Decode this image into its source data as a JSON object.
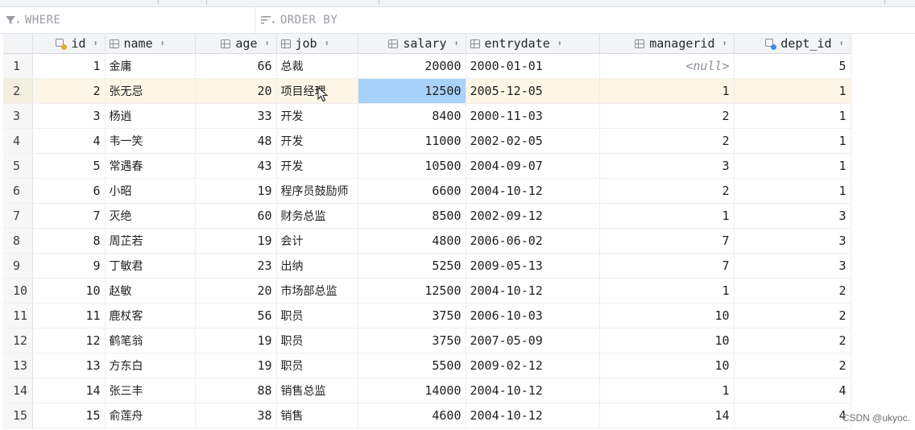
{
  "filter": {
    "where_placeholder": "WHERE",
    "orderby_placeholder": "ORDER BY"
  },
  "columns": [
    {
      "key": "id",
      "label": "id",
      "icon": "primary-key-icon"
    },
    {
      "key": "name",
      "label": "name",
      "icon": "column-icon"
    },
    {
      "key": "age",
      "label": "age",
      "icon": "column-icon"
    },
    {
      "key": "job",
      "label": "job",
      "icon": "column-icon"
    },
    {
      "key": "salary",
      "label": "salary",
      "icon": "column-icon"
    },
    {
      "key": "entrydate",
      "label": "entrydate",
      "icon": "column-icon"
    },
    {
      "key": "managerid",
      "label": "managerid",
      "icon": "column-icon"
    },
    {
      "key": "dept_id",
      "label": "dept_id",
      "icon": "foreign-key-icon"
    }
  ],
  "rows": [
    {
      "n": "1",
      "id": "1",
      "name": "金庸",
      "age": "66",
      "job": "总裁",
      "salary": "20000",
      "entrydate": "2000-01-01",
      "managerid": "<null>",
      "dept_id": "5"
    },
    {
      "n": "2",
      "id": "2",
      "name": "张无忌",
      "age": "20",
      "job": "项目经理",
      "salary": "12500",
      "entrydate": "2005-12-05",
      "managerid": "1",
      "dept_id": "1"
    },
    {
      "n": "3",
      "id": "3",
      "name": "杨逍",
      "age": "33",
      "job": "开发",
      "salary": "8400",
      "entrydate": "2000-11-03",
      "managerid": "2",
      "dept_id": "1"
    },
    {
      "n": "4",
      "id": "4",
      "name": "韦一笑",
      "age": "48",
      "job": "开发",
      "salary": "11000",
      "entrydate": "2002-02-05",
      "managerid": "2",
      "dept_id": "1"
    },
    {
      "n": "5",
      "id": "5",
      "name": "常遇春",
      "age": "43",
      "job": "开发",
      "salary": "10500",
      "entrydate": "2004-09-07",
      "managerid": "3",
      "dept_id": "1"
    },
    {
      "n": "6",
      "id": "6",
      "name": "小昭",
      "age": "19",
      "job": "程序员鼓励师",
      "salary": "6600",
      "entrydate": "2004-10-12",
      "managerid": "2",
      "dept_id": "1"
    },
    {
      "n": "7",
      "id": "7",
      "name": "灭绝",
      "age": "60",
      "job": "财务总监",
      "salary": "8500",
      "entrydate": "2002-09-12",
      "managerid": "1",
      "dept_id": "3"
    },
    {
      "n": "8",
      "id": "8",
      "name": "周芷若",
      "age": "19",
      "job": "会计",
      "salary": "4800",
      "entrydate": "2006-06-02",
      "managerid": "7",
      "dept_id": "3"
    },
    {
      "n": "9",
      "id": "9",
      "name": "丁敏君",
      "age": "23",
      "job": "出纳",
      "salary": "5250",
      "entrydate": "2009-05-13",
      "managerid": "7",
      "dept_id": "3"
    },
    {
      "n": "10",
      "id": "10",
      "name": "赵敏",
      "age": "20",
      "job": "市场部总监",
      "salary": "12500",
      "entrydate": "2004-10-12",
      "managerid": "1",
      "dept_id": "2"
    },
    {
      "n": "11",
      "id": "11",
      "name": "鹿杖客",
      "age": "56",
      "job": "职员",
      "salary": "3750",
      "entrydate": "2006-10-03",
      "managerid": "10",
      "dept_id": "2"
    },
    {
      "n": "12",
      "id": "12",
      "name": "鹤笔翁",
      "age": "19",
      "job": "职员",
      "salary": "3750",
      "entrydate": "2007-05-09",
      "managerid": "10",
      "dept_id": "2"
    },
    {
      "n": "13",
      "id": "13",
      "name": "方东白",
      "age": "19",
      "job": "职员",
      "salary": "5500",
      "entrydate": "2009-02-12",
      "managerid": "10",
      "dept_id": "2"
    },
    {
      "n": "14",
      "id": "14",
      "name": "张三丰",
      "age": "88",
      "job": "销售总监",
      "salary": "14000",
      "entrydate": "2004-10-12",
      "managerid": "1",
      "dept_id": "4"
    },
    {
      "n": "15",
      "id": "15",
      "name": "俞莲舟",
      "age": "38",
      "job": "销售",
      "salary": "4600",
      "entrydate": "2004-10-12",
      "managerid": "14",
      "dept_id": "4"
    }
  ],
  "selection": {
    "row": "2",
    "column": "salary"
  },
  "watermark": "CSDN @ukyoc."
}
